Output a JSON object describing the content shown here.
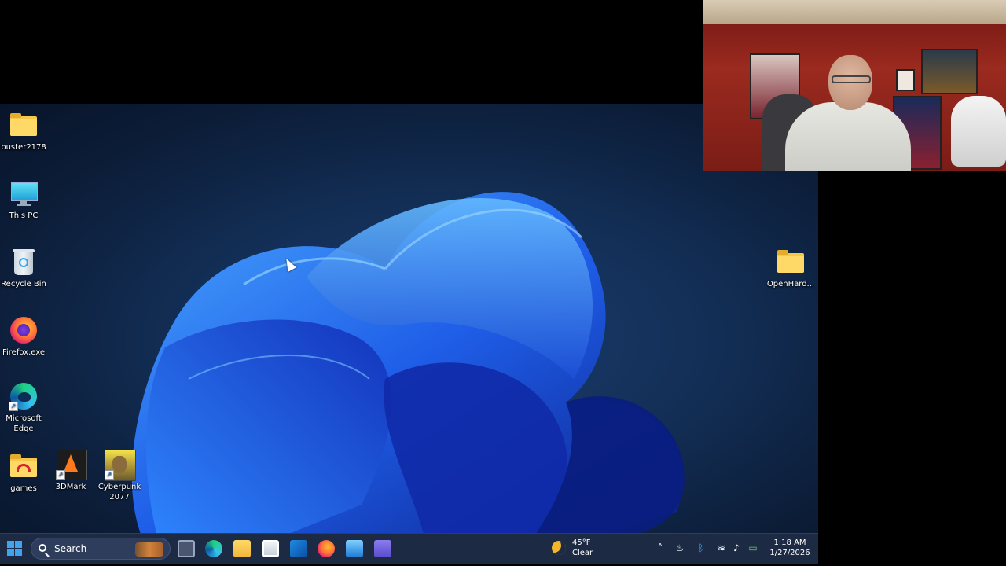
{
  "desktop": {
    "icons_left": [
      {
        "label": "buster2178",
        "icon": "folder-icon"
      },
      {
        "label": "This PC",
        "icon": "monitor-icon"
      },
      {
        "label": "Recycle Bin",
        "icon": "recycle-bin-icon"
      },
      {
        "label": "Firefox.exe",
        "icon": "firefox-icon"
      },
      {
        "label": "Microsoft Edge",
        "icon": "edge-icon"
      },
      {
        "label": "games",
        "icon": "games-folder-icon"
      },
      {
        "label": "3DMark",
        "icon": "3dmark-icon"
      },
      {
        "label": "Cyberpunk 2077",
        "icon": "cyberpunk-icon"
      }
    ],
    "icon_right": {
      "label": "OpenHard...",
      "icon": "folder-icon"
    },
    "wallpaper": "windows-11-bloom",
    "accent_color": "#1a4fd8"
  },
  "taskbar": {
    "search_placeholder": "Search",
    "apps": [
      "task-view-icon",
      "edge-icon",
      "file-explorer-icon",
      "store-icon",
      "outlook-icon",
      "firefox-icon",
      "app-icon",
      "teams-icon"
    ],
    "weather": {
      "temp": "45°F",
      "condition": "Clear"
    },
    "tray": [
      "chevron-up-icon",
      "steam-icon",
      "bluetooth-icon",
      "wifi-icon",
      "volume-icon",
      "battery-icon"
    ],
    "clock": {
      "time": "1:18 AM",
      "date": "1/27/2026"
    }
  },
  "webcam": {
    "description_icon": "webcam-overlay"
  }
}
